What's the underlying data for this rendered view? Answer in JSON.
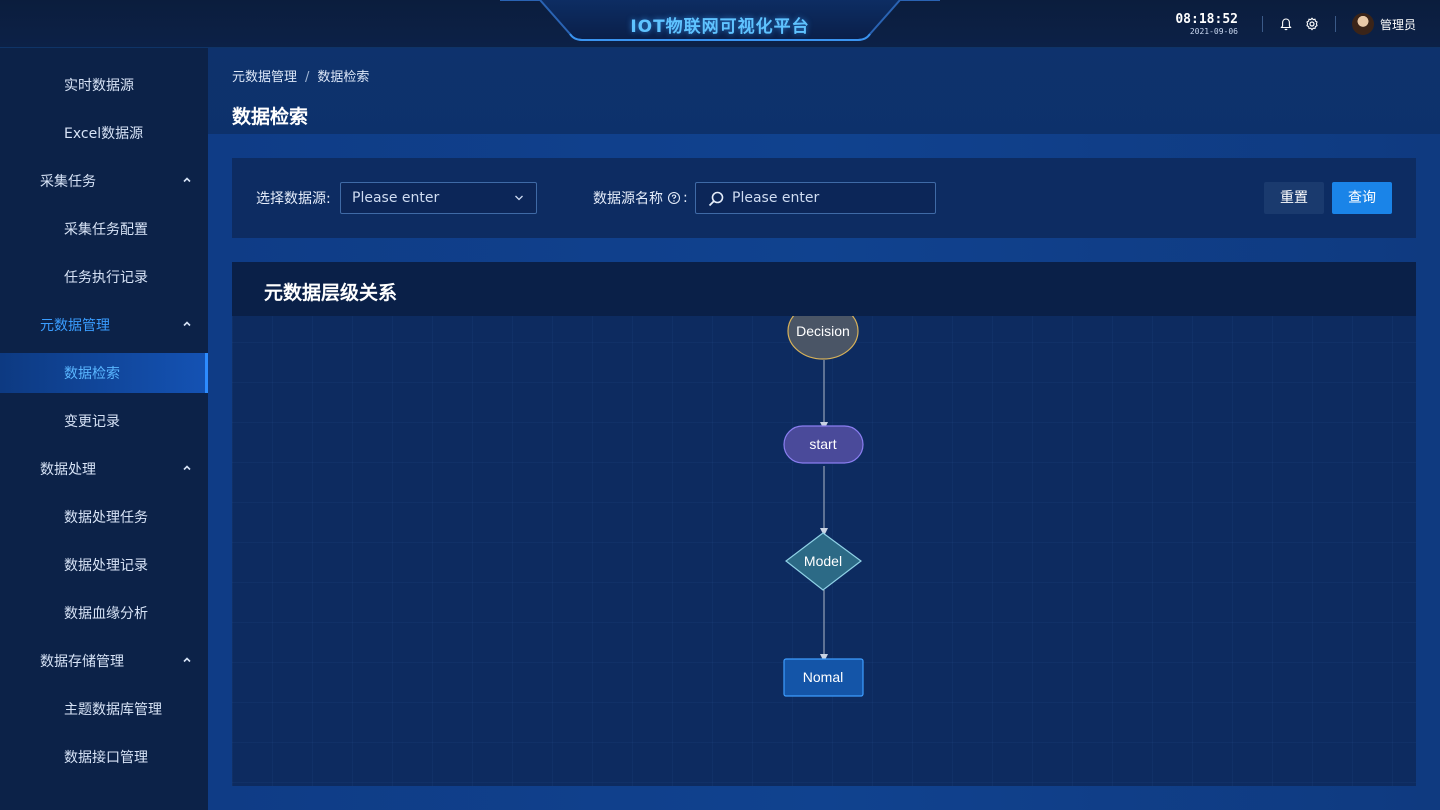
{
  "header": {
    "title": "IOT物联网可视化平台",
    "time": "08:18:52",
    "date": "2021-09-06",
    "user": "管理员",
    "accent": "#5fc3ff"
  },
  "sidebar": {
    "items": [
      {
        "label": "实时数据源",
        "level": "sub"
      },
      {
        "label": "Excel数据源",
        "level": "sub"
      },
      {
        "label": "采集任务",
        "level": "group",
        "expanded": true
      },
      {
        "label": "采集任务配置",
        "level": "sub"
      },
      {
        "label": "任务执行记录",
        "level": "sub"
      },
      {
        "label": "元数据管理",
        "level": "group",
        "expanded": true,
        "active_group": true
      },
      {
        "label": "数据检索",
        "level": "sub",
        "active": true
      },
      {
        "label": "变更记录",
        "level": "sub"
      },
      {
        "label": "数据处理",
        "level": "group",
        "expanded": true
      },
      {
        "label": "数据处理任务",
        "level": "sub"
      },
      {
        "label": "数据处理记录",
        "level": "sub"
      },
      {
        "label": "数据血缘分析",
        "level": "sub"
      },
      {
        "label": "数据存储管理",
        "level": "group",
        "expanded": true
      },
      {
        "label": "主题数据库管理",
        "level": "sub"
      },
      {
        "label": "数据接口管理",
        "level": "sub"
      }
    ]
  },
  "breadcrumb": {
    "parent": "元数据管理",
    "separator": "/",
    "current": "数据检索"
  },
  "page_title": "数据检索",
  "filter": {
    "source_label": "选择数据源:",
    "source_placeholder": "Please enter",
    "name_label": "数据源名称",
    "name_colon": ":",
    "name_placeholder": "Please enter",
    "reset_label": "重置",
    "query_label": "查询"
  },
  "graph": {
    "title": "元数据层级关系",
    "nodes": [
      {
        "label": "Decision",
        "shape": "ellipse",
        "fill": "#4a5566",
        "stroke": "#d6b15a"
      },
      {
        "label": "start",
        "shape": "rounded",
        "fill": "#4a4a9a",
        "stroke": "#8a7ef0"
      },
      {
        "label": "Model",
        "shape": "diamond",
        "fill": "#2c6a86",
        "stroke": "#8fd1e6"
      },
      {
        "label": "Nomal",
        "shape": "rect",
        "fill": "#1455a8",
        "stroke": "#3e9dff"
      }
    ]
  }
}
